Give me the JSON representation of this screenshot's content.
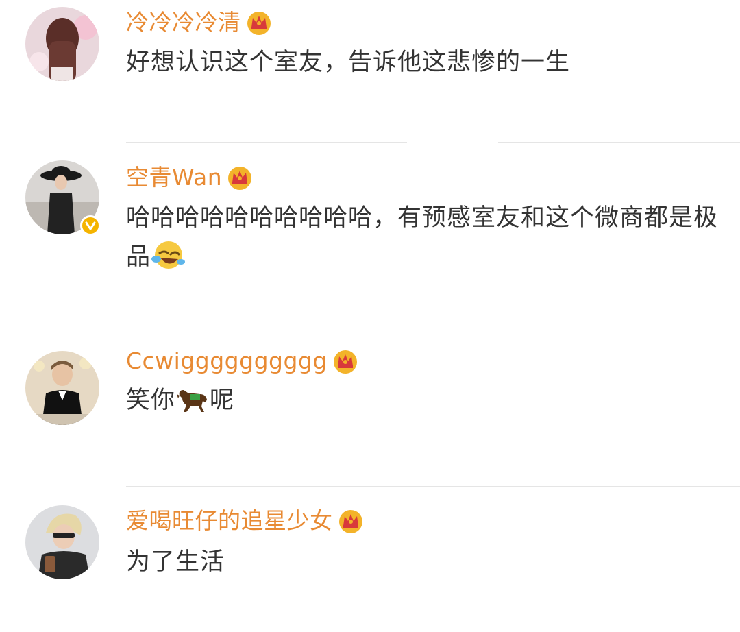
{
  "comments": [
    {
      "username": "冷冷冷冷清",
      "text": "好想认识这个室友，告诉他这悲惨的一生",
      "avatar_icon": "avatar-girl-long-hair",
      "badge_icon": "crown-icon"
    },
    {
      "username": "空青Wan",
      "text": "哈哈哈哈哈哈哈哈哈哈，有预感室友和这个微商都是极品",
      "trailing_emoji": "laugh-cry-emoji-icon",
      "avatar_icon": "avatar-woman-black-hat",
      "verified_icon": "verified-v-badge-icon",
      "badge_icon": "crown-icon"
    },
    {
      "username": "Ccwigggggggggg",
      "text_before": "笑你",
      "inline_emoji": "horse-emoji-icon",
      "text_after": "呢",
      "avatar_icon": "avatar-man-tuxedo",
      "badge_icon": "crown-icon"
    },
    {
      "username": "爱喝旺仔的追星少女",
      "text": "为了生活",
      "avatar_icon": "avatar-blond-sunglasses",
      "badge_icon": "crown-icon"
    }
  ],
  "colors": {
    "username": "#e88a33",
    "text": "#333333",
    "divider": "#e5e5e5",
    "crown_gold": "#f3b32a",
    "crown_red": "#d8393b",
    "verified": "#f5b400"
  }
}
